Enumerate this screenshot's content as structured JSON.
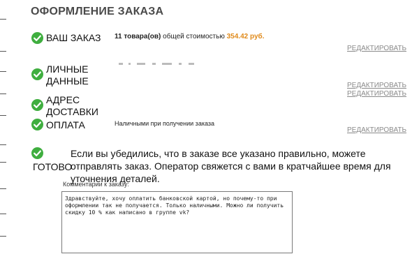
{
  "page": {
    "title": "ОФОРМЛЕНИЕ ЗАКАЗА"
  },
  "steps": {
    "order": {
      "label": "ВАШ ЗАКАЗ",
      "count": "11 товара(ов)",
      "total_text": "общей стоимостью",
      "price": "354.42 руб.",
      "edit": "РЕДАКТИРОВАТЬ"
    },
    "personal": {
      "label_line1": "ЛИЧНЫЕ",
      "label_line2": "ДАННЫЕ",
      "edit": "РЕДАКТИРОВАТЬ"
    },
    "address": {
      "label_line1": "АДРЕС",
      "label_line2": "ДОСТАВКИ",
      "edit": "РЕДАКТИРОВАТЬ"
    },
    "payment": {
      "label": "ОПЛАТА",
      "value": "Наличными при получении заказа",
      "edit": "РЕДАКТИРОВАТЬ"
    },
    "ready": {
      "label": "ГОТОВО",
      "text": "Если вы убедились, что в заказе все указано правильно, можете отправлять заказ. Оператор свяжется с вами в кратчайшее время для уточнения деталей."
    }
  },
  "comments": {
    "label": "Комментарии к заказу:",
    "value": "Здравствуйте, хочу оплатить банковской картой, но почему-то при оформлении так не получается. Только наличными. Можно ли получить скидку 10 % как написано в группе vk?"
  },
  "colors": {
    "check": "#3fae3f",
    "price": "#e08a1a",
    "edit_link": "#8a8a8a"
  }
}
